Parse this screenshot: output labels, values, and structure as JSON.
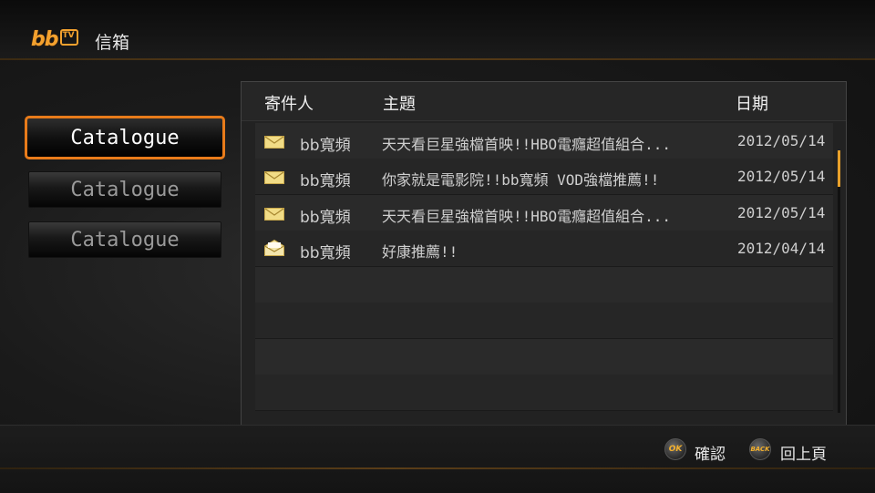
{
  "header": {
    "logo_text": "bb",
    "logo_badge": "TV",
    "title": "信箱"
  },
  "catalogues": [
    {
      "label": "Catalogue",
      "active": true
    },
    {
      "label": "Catalogue",
      "active": false
    },
    {
      "label": "Catalogue",
      "active": false
    }
  ],
  "mailbox": {
    "columns": {
      "sender": "寄件人",
      "subject": "主題",
      "date": "日期"
    },
    "rows": [
      {
        "icon": "envelope-closed-icon",
        "sender": "bb寬頻",
        "subject": "天天看巨星強檔首映!!HBO電癮超值組合...",
        "date": "2012/05/14"
      },
      {
        "icon": "envelope-closed-icon",
        "sender": "bb寬頻",
        "subject": "你家就是電影院!!bb寬頻 VOD強檔推薦!!",
        "date": "2012/05/14"
      },
      {
        "icon": "envelope-closed-icon",
        "sender": "bb寬頻",
        "subject": "天天看巨星強檔首映!!HBO電癮超值組合...",
        "date": "2012/05/14"
      },
      {
        "icon": "envelope-open-icon",
        "sender": "bb寬頻",
        "subject": "好康推薦!!",
        "date": "2012/04/14"
      }
    ]
  },
  "footer": {
    "ok_key": "OK",
    "ok_label": "確認",
    "back_key": "BACK",
    "back_label": "回上頁"
  },
  "colors": {
    "accent": "#e87b1a",
    "scroll_thumb": "#e8a02a"
  }
}
